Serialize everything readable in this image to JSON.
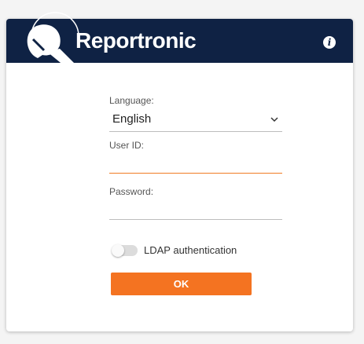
{
  "brand": {
    "name": "Reportronic",
    "logo_icon": "reportronic-logo-icon",
    "header_color": "#0f2244",
    "accent_color": "#f47321"
  },
  "header": {
    "info_glyph": "i",
    "info_icon": "info-icon"
  },
  "form": {
    "language_label": "Language:",
    "language_value": "English",
    "userid_label": "User ID:",
    "userid_value": "",
    "password_label": "Password:",
    "password_value": ""
  },
  "ldap": {
    "label": "LDAP authentication",
    "enabled": false
  },
  "actions": {
    "ok_label": "OK"
  }
}
